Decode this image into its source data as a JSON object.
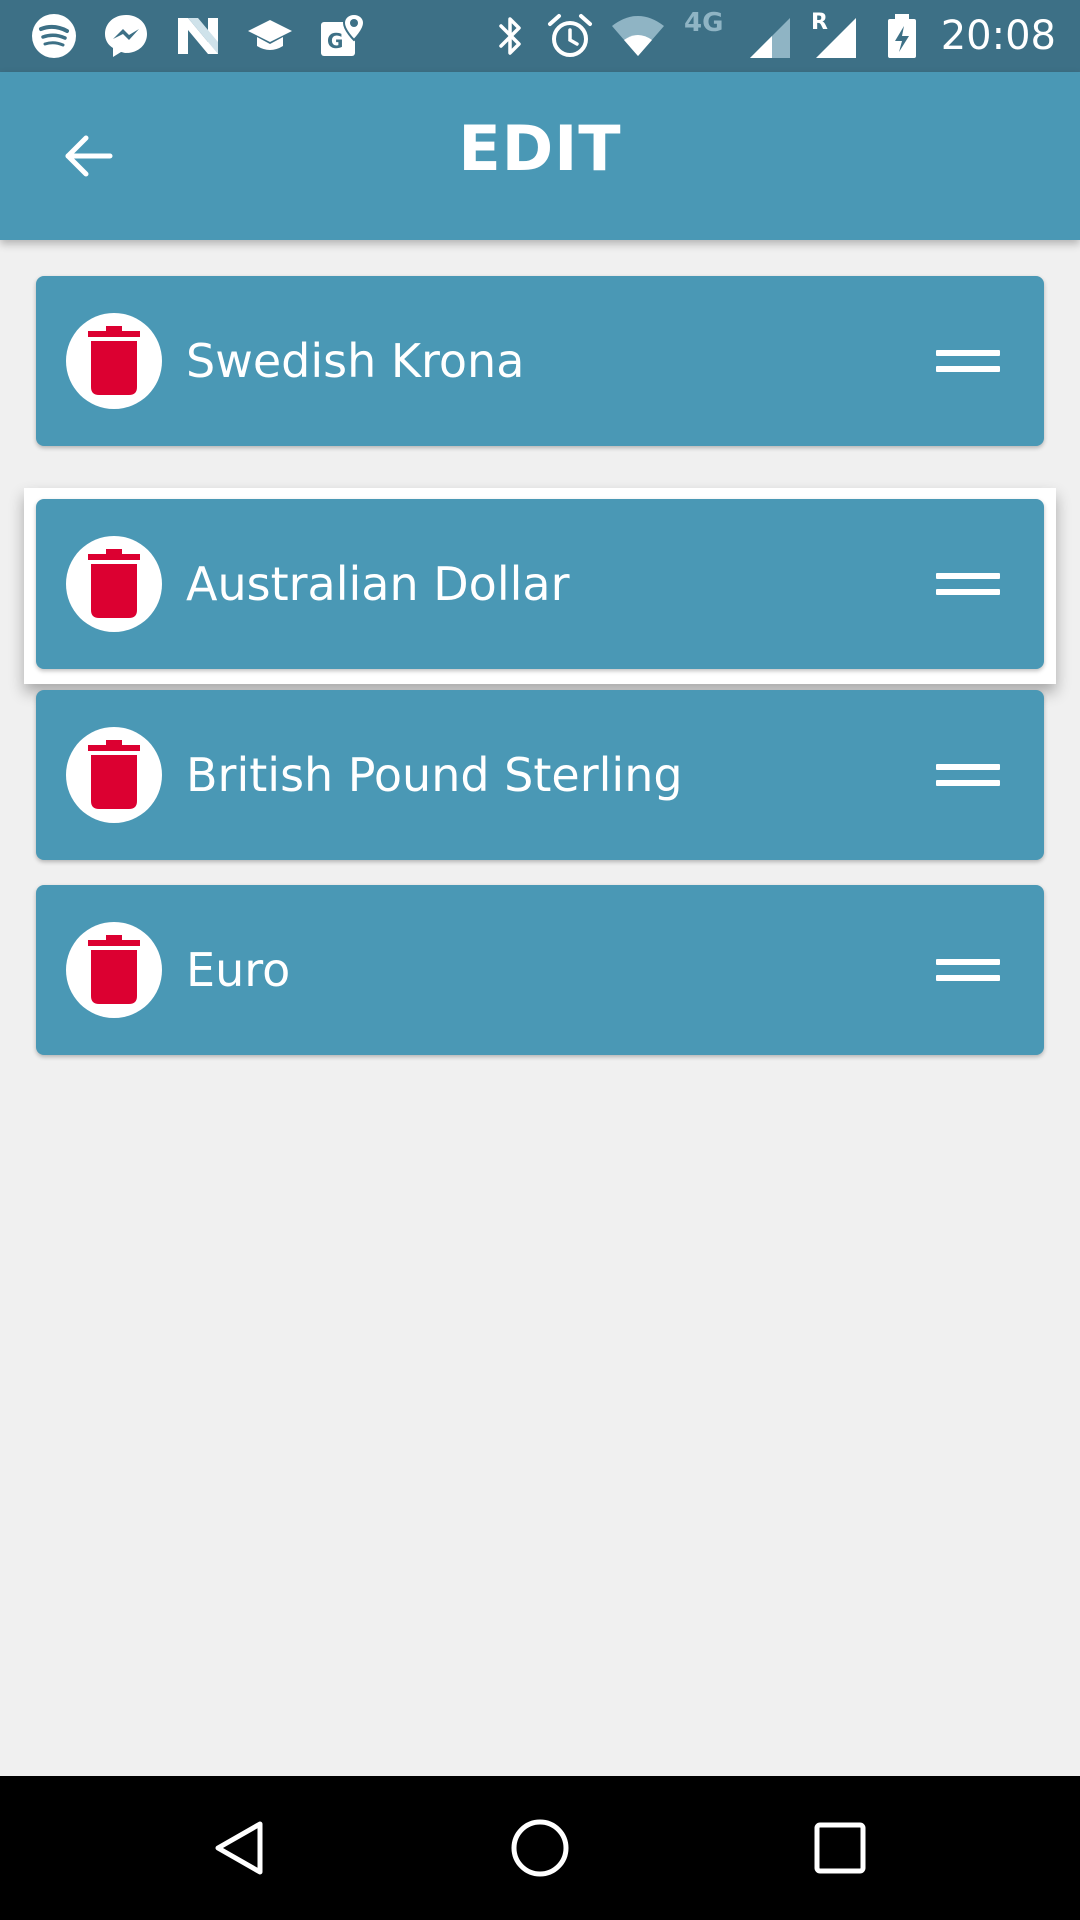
{
  "status_bar": {
    "time": "20:08",
    "network": "4G",
    "roaming": "R",
    "icons": [
      "spotify-icon",
      "messenger-icon",
      "n-app-icon",
      "graduation-cap-icon",
      "maps-icon",
      "bluetooth-icon",
      "alarm-icon",
      "wifi-icon",
      "signal-icon",
      "roaming-signal-icon",
      "battery-charging-icon"
    ]
  },
  "app_bar": {
    "title": "EDIT",
    "back_icon": "arrow-back-icon"
  },
  "currencies": [
    {
      "label": "Swedish Krona"
    },
    {
      "label": "Australian Dollar"
    },
    {
      "label": "British Pound Sterling"
    },
    {
      "label": "Euro"
    }
  ],
  "icons": {
    "delete": "trash-icon",
    "reorder": "drag-handle-icon"
  },
  "nav_bar": {
    "icons": [
      "back-triangle-icon",
      "home-circle-icon",
      "recents-square-icon"
    ]
  },
  "colors": {
    "status_bar": "#3d7086",
    "primary": "#4a98b5",
    "delete_red": "#dc0031",
    "background": "#f0f0f0"
  }
}
